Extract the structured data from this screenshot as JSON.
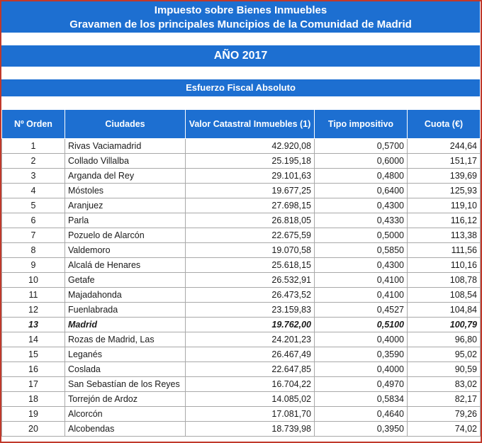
{
  "header": {
    "title_line1": "Impuesto sobre Bienes Inmuebles",
    "title_line2": "Gravamen de los principales Muncipios de la Comunidad de Madrid",
    "year": "AÑO 2017",
    "section": "Esfuerzo Fiscal Absoluto"
  },
  "table": {
    "columns": [
      "Nº Orden",
      "Ciudades",
      "Valor Catastral Inmuebles (1)",
      "Tipo impositivo",
      "Cuota (€)"
    ],
    "rows": [
      {
        "order": "1",
        "city": "Rivas Vaciamadrid",
        "value": "42.920,08",
        "rate": "0,5700",
        "quota": "244,64"
      },
      {
        "order": "2",
        "city": "Collado Villalba",
        "value": "25.195,18",
        "rate": "0,6000",
        "quota": "151,17"
      },
      {
        "order": "3",
        "city": "Arganda del Rey",
        "value": "29.101,63",
        "rate": "0,4800",
        "quota": "139,69"
      },
      {
        "order": "4",
        "city": "Móstoles",
        "value": "19.677,25",
        "rate": "0,6400",
        "quota": "125,93"
      },
      {
        "order": "5",
        "city": "Aranjuez",
        "value": "27.698,15",
        "rate": "0,4300",
        "quota": "119,10"
      },
      {
        "order": "6",
        "city": "Parla",
        "value": "26.818,05",
        "rate": "0,4330",
        "quota": "116,12"
      },
      {
        "order": "7",
        "city": "Pozuelo de Alarcón",
        "value": "22.675,59",
        "rate": "0,5000",
        "quota": "113,38"
      },
      {
        "order": "8",
        "city": "Valdemoro",
        "value": "19.070,58",
        "rate": "0,5850",
        "quota": "111,56"
      },
      {
        "order": "9",
        "city": "Alcalá de Henares",
        "value": "25.618,15",
        "rate": "0,4300",
        "quota": "110,16"
      },
      {
        "order": "10",
        "city": "Getafe",
        "value": "26.532,91",
        "rate": "0,4100",
        "quota": "108,78"
      },
      {
        "order": "11",
        "city": "Majadahonda",
        "value": "26.473,52",
        "rate": "0,4100",
        "quota": "108,54"
      },
      {
        "order": "12",
        "city": "Fuenlabrada",
        "value": "23.159,83",
        "rate": "0,4527",
        "quota": "104,84"
      },
      {
        "order": "13",
        "city": "Madrid",
        "value": "19.762,00",
        "rate": "0,5100",
        "quota": "100,79",
        "highlight": true
      },
      {
        "order": "14",
        "city": "Rozas de Madrid, Las",
        "value": "24.201,23",
        "rate": "0,4000",
        "quota": "96,80"
      },
      {
        "order": "15",
        "city": "Leganés",
        "value": "26.467,49",
        "rate": "0,3590",
        "quota": "95,02"
      },
      {
        "order": "16",
        "city": "Coslada",
        "value": "22.647,85",
        "rate": "0,4000",
        "quota": "90,59"
      },
      {
        "order": "17",
        "city": "San Sebastían de los Reyes",
        "value": "16.704,22",
        "rate": "0,4970",
        "quota": "83,02"
      },
      {
        "order": "18",
        "city": "Torrejón de Ardoz",
        "value": "14.085,02",
        "rate": "0,5834",
        "quota": "82,17"
      },
      {
        "order": "19",
        "city": "Alcorcón",
        "value": "17.081,70",
        "rate": "0,4640",
        "quota": "79,26"
      },
      {
        "order": "20",
        "city": "Alcobendas",
        "value": "18.739,98",
        "rate": "0,3950",
        "quota": "74,02"
      }
    ]
  },
  "colors": {
    "header_blue": "#1d6fd1",
    "border_red": "#c0392b"
  }
}
